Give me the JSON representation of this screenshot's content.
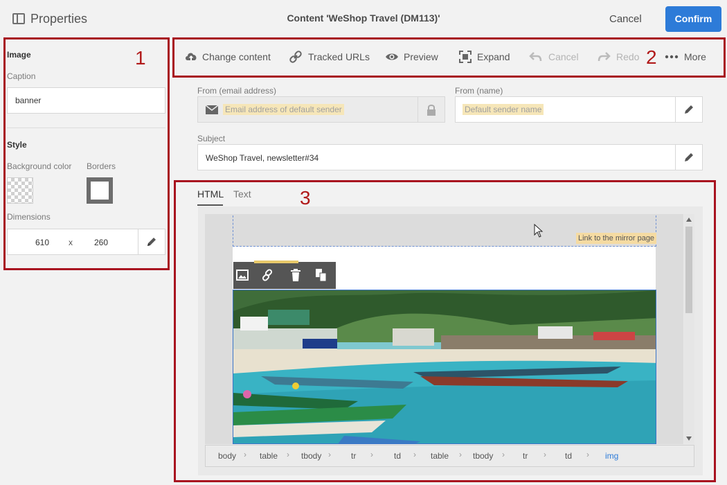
{
  "header": {
    "panel_title": "Properties",
    "content_title": "Content 'WeShop Travel (DM113)'",
    "cancel_label": "Cancel",
    "confirm_label": "Confirm"
  },
  "annotations": [
    "1",
    "2",
    "3"
  ],
  "left_panel": {
    "image_heading": "Image",
    "caption_label": "Caption",
    "caption_value": "banner",
    "style_heading": "Style",
    "background_color_label": "Background color",
    "borders_label": "Borders",
    "dimensions_label": "Dimensions",
    "width": "610",
    "times": "x",
    "height": "260"
  },
  "toolbar": {
    "change_content": "Change content",
    "tracked_urls": "Tracked URLs",
    "preview": "Preview",
    "expand": "Expand",
    "cancel": "Cancel",
    "redo": "Redo",
    "more": "More"
  },
  "form": {
    "from_email_label": "From (email address)",
    "from_email_placeholder": "Email address of default sender",
    "from_name_label": "From (name)",
    "from_name_placeholder": "Default sender name",
    "subject_label": "Subject",
    "subject_value": "WeShop Travel, newsletter#34"
  },
  "editor": {
    "tab_html": "HTML",
    "tab_text": "Text",
    "mirror_link": "Link to the mirror page",
    "breadcrumbs": [
      "body",
      "table",
      "tbody",
      "tr",
      "td",
      "table",
      "tbody",
      "tr",
      "td",
      "img"
    ]
  },
  "colors": {
    "accent": "#2d7bd8",
    "annotation": "#a8121f",
    "highlight": "#f6e6b8"
  }
}
